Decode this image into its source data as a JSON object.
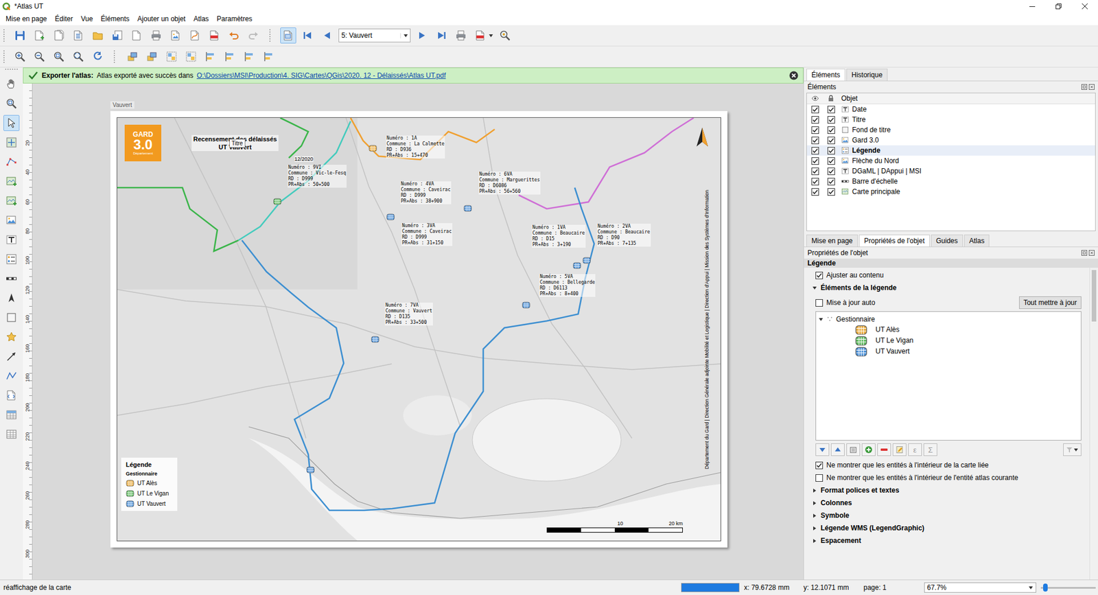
{
  "window": {
    "title": "*Atlas UT"
  },
  "menu": [
    "Mise en page",
    "Éditer",
    "Vue",
    "Éléments",
    "Ajouter un objet",
    "Atlas",
    "Paramètres"
  ],
  "atlas_toolbar": {
    "preview_on": true,
    "feature": "5: Vauvert"
  },
  "left_toolbar": [
    {
      "kind": "hand",
      "selected": false
    },
    {
      "kind": "zoom",
      "selected": false
    },
    {
      "kind": "cursor",
      "selected": true
    },
    {
      "kind": "move",
      "selected": false
    },
    {
      "kind": "nodes",
      "selected": false
    },
    {
      "kind": "addmap",
      "selected": false
    },
    {
      "kind": "add3d",
      "selected": false
    },
    {
      "kind": "addpic",
      "selected": false
    },
    {
      "kind": "addtext",
      "selected": false
    },
    {
      "kind": "addlegend",
      "selected": false
    },
    {
      "kind": "addscalebar",
      "selected": false
    },
    {
      "kind": "addnorth",
      "selected": false
    },
    {
      "kind": "addshape",
      "selected": false
    },
    {
      "kind": "addmarker",
      "selected": false
    },
    {
      "kind": "addarrow",
      "selected": false
    },
    {
      "kind": "addpolyline",
      "selected": false
    },
    {
      "kind": "addhtml",
      "selected": false
    },
    {
      "kind": "addtable",
      "selected": false
    },
    {
      "kind": "addfixedtable",
      "selected": false
    }
  ],
  "message": {
    "title": "Exporter l'atlas:",
    "text": "Atlas exporté avec succès dans",
    "link": "O:\\Dossiers\\MSI\\Production\\4. SIG\\Cartes\\QGis\\2020. 12 - Délaissés\\Atlas UT.pdf"
  },
  "ruler": {
    "vertical": [
      "20",
      "40",
      "60",
      "80",
      "100",
      "120",
      "140",
      "160",
      "180",
      "200",
      "220",
      "240",
      "260",
      "280",
      "300"
    ]
  },
  "page": {
    "label": "Vauvert"
  },
  "map": {
    "logo": {
      "name": "GARD",
      "number": "3.0",
      "sub": "Département"
    },
    "title": [
      "Recensement des délaissés",
      "UT Vauvert"
    ],
    "tooltip": "Titre",
    "date": "12/2020",
    "callouts": [
      {
        "lines": [
          "Numéro : 1A",
          "Commune : La Calmette",
          "RD : D936",
          "PR+Abs : 15+470"
        ]
      },
      {
        "lines": [
          "Numéro : 9VI",
          "Commune : Vic-le-Fesq",
          "RD : D999",
          "PR+Abs : 50+500"
        ]
      },
      {
        "lines": [
          "Numéro : 4VA",
          "Commune : Caveirac",
          "RD : D999",
          "PR+Abs : 38+900"
        ]
      },
      {
        "lines": [
          "Numéro : 6VA",
          "Commune : Marguerittes",
          "RD : D6086",
          "PR+Abs : 56+560"
        ]
      },
      {
        "lines": [
          "Numéro : 3VA",
          "Commune : Caveirac",
          "RD : D999",
          "PR+Abs : 31+150"
        ]
      },
      {
        "lines": [
          "Numéro : 1VA",
          "Commune : Beaucaire",
          "RD : D15",
          "PR+Abs : 3+190"
        ]
      },
      {
        "lines": [
          "Numéro : 2VA",
          "Commune : Beaucaire",
          "RD : D90",
          "PR+Abs : 7+135"
        ]
      },
      {
        "lines": [
          "Numéro : 5VA",
          "Commune : Bellegarde",
          "RD : D6113",
          "PR+Abs : 8+400"
        ]
      },
      {
        "lines": [
          "Numéro : 7VA",
          "Commune : Vauvert",
          "RD : D135",
          "PR+Abs : 33+500"
        ]
      }
    ],
    "pins": [
      {
        "color": "#e8a838"
      },
      {
        "color": "#5cb85c"
      },
      {
        "color": "#4a8fd6"
      },
      {
        "color": "#4a8fd6"
      },
      {
        "color": "#4a8fd6"
      },
      {
        "color": "#4a8fd6"
      },
      {
        "color": "#4a8fd6"
      },
      {
        "color": "#4a8fd6"
      },
      {
        "color": "#4a8fd6"
      }
    ],
    "legend": {
      "title": "Légende",
      "group": "Gestionnaire",
      "items": [
        {
          "label": "UT Alès",
          "color": "#e8a838"
        },
        {
          "label": "UT Le Vigan",
          "color": "#5cb85c"
        },
        {
          "label": "UT Vauvert",
          "color": "#4a8fd6"
        }
      ]
    },
    "scalebar": [
      "10",
      "20 km"
    ],
    "credits": "Département du Gard | Direction Générale adjointe Mobilité et Logistique | Direction d'Appui | Mission des Systèmes d'Information"
  },
  "elements_panel": {
    "tabs": [
      {
        "label": "Éléments",
        "selected": true
      },
      {
        "label": "Historique",
        "selected": false
      }
    ],
    "title": "Éléments",
    "header": "Objet",
    "items": [
      {
        "label": "Date",
        "kind": "text",
        "visible": true,
        "locked": true,
        "selected": false
      },
      {
        "label": "Titre",
        "kind": "text",
        "visible": true,
        "locked": true,
        "selected": false
      },
      {
        "label": "Fond de titre",
        "kind": "shape",
        "visible": true,
        "locked": true,
        "selected": false
      },
      {
        "label": "Gard 3.0",
        "kind": "picture",
        "visible": true,
        "locked": true,
        "selected": false
      },
      {
        "label": "Légende",
        "kind": "legend",
        "visible": true,
        "locked": true,
        "selected": true
      },
      {
        "label": "Flèche du Nord",
        "kind": "picture",
        "visible": true,
        "locked": true,
        "selected": false
      },
      {
        "label": "DGaML | DAppui | MSI",
        "kind": "text",
        "visible": true,
        "locked": true,
        "selected": false
      },
      {
        "label": "Barre d'échelle",
        "kind": "scalebar",
        "visible": true,
        "locked": true,
        "selected": false
      },
      {
        "label": "Carte principale",
        "kind": "map",
        "visible": true,
        "locked": true,
        "selected": false
      }
    ]
  },
  "properties_panel": {
    "tabs": [
      {
        "label": "Mise en page",
        "selected": false
      },
      {
        "label": "Propriétés de l'objet",
        "selected": true
      },
      {
        "label": "Guides",
        "selected": false
      },
      {
        "label": "Atlas",
        "selected": false
      }
    ],
    "title": "Propriétés de l'objet",
    "item": "Légende",
    "fit": {
      "label": "Ajuster au contenu",
      "checked": true
    },
    "section": {
      "label": "Éléments de la légende",
      "expanded": true
    },
    "auto_update": {
      "label": "Mise à jour auto",
      "checked": false
    },
    "update_button": "Tout mettre à jour",
    "tree": {
      "group": "Gestionnaire",
      "expanded": true,
      "items": [
        {
          "label": "UT Alès",
          "color": "#e8a838"
        },
        {
          "label": "UT Le Vigan",
          "color": "#5cb85c"
        },
        {
          "label": "UT Vauvert",
          "color": "#4a8fd6"
        }
      ]
    },
    "glyph_buttons": [
      {
        "label": "ε",
        "disabled": true
      },
      {
        "label": "Σ",
        "disabled": true
      }
    ],
    "options": [
      {
        "label": "Ne montrer que les entités à l'intérieur de la carte liée",
        "checked": true
      },
      {
        "label": "Ne montrer que les entités à l'intérieur de l'entité atlas courante",
        "checked": false
      }
    ],
    "sections": [
      {
        "label": "Format polices et textes",
        "expanded": false
      },
      {
        "label": "Colonnes",
        "expanded": false
      },
      {
        "label": "Symbole",
        "expanded": false
      },
      {
        "label": "Légende WMS (LegendGraphic)",
        "expanded": false
      },
      {
        "label": "Espacement",
        "expanded": false
      }
    ]
  },
  "status_bar": {
    "message": "réaffichage de la carte",
    "progress": 1,
    "x": "x: 79.6728 mm",
    "y": "y: 12.1071 mm",
    "page": "page: 1",
    "zoom": "67.7%",
    "zoom_slider": 0.04
  }
}
